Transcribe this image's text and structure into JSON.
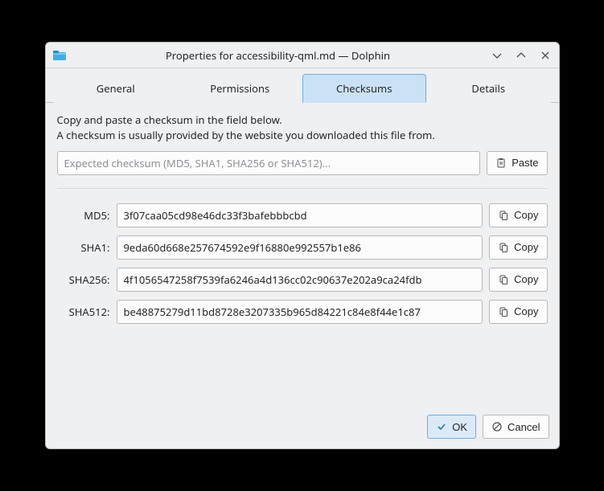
{
  "titlebar": {
    "title": "Properties for accessibility-qml.md — Dolphin"
  },
  "tabs": {
    "general": "General",
    "permissions": "Permissions",
    "checksums": "Checksums",
    "details": "Details"
  },
  "desc": {
    "line1": "Copy and paste a checksum in the field below.",
    "line2": "A checksum is usually provided by the website you downloaded this file from."
  },
  "input": {
    "placeholder": "Expected checksum (MD5, SHA1, SHA256 or SHA512)...",
    "value": ""
  },
  "buttons": {
    "paste": "Paste",
    "copy": "Copy",
    "ok": "OK",
    "cancel": "Cancel"
  },
  "hashes": {
    "md5": {
      "label": "MD5:",
      "value": "3f07caa05cd98e46dc33f3bafebbbcbd"
    },
    "sha1": {
      "label": "SHA1:",
      "value": "9eda60d668e257674592e9f16880e992557b1e86"
    },
    "sha256": {
      "label": "SHA256:",
      "value": "4f1056547258f7539fa6246a4d136cc02c90637e202a9ca24fdb"
    },
    "sha512": {
      "label": "SHA512:",
      "value": "be48875279d11bd8728e3207335b965d84221c84e8f44e1c87"
    }
  }
}
